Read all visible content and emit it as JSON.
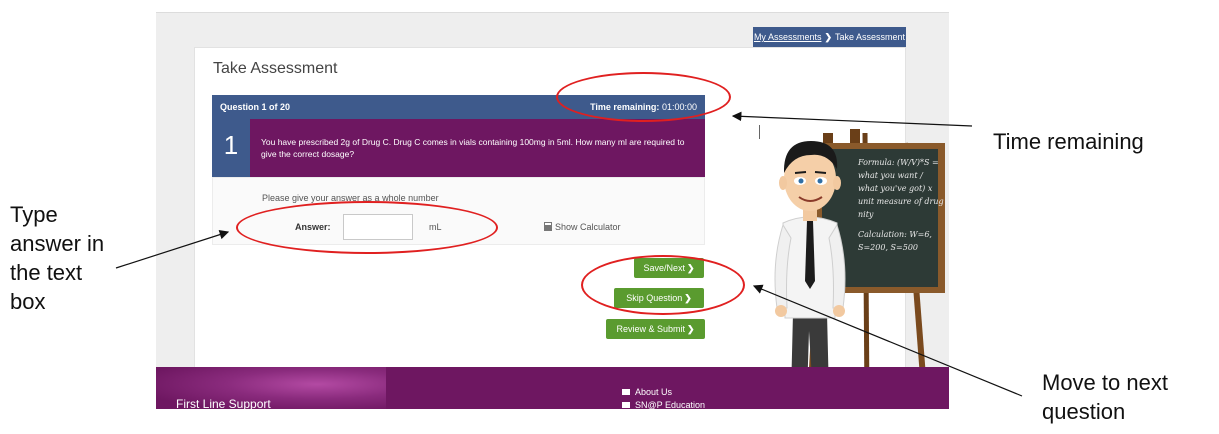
{
  "annotations": {
    "type_answer": "Type answer in the text box",
    "time_remaining": "Time remaining",
    "move_next": "Move to next question"
  },
  "breadcrumb": {
    "link": "My Assessments",
    "separator": "❯",
    "current": "Take Assessment"
  },
  "page_title": "Take Assessment",
  "question": {
    "counter": "Question 1 of 20",
    "time_label": "Time remaining:",
    "time_value": "01:00:00",
    "number": "1",
    "text": "You have prescribed 2g of Drug C. Drug C comes in vials containing 100mg in 5ml. How many ml are required to give the correct dosage?"
  },
  "answer": {
    "instruction": "Please give your answer as a whole number",
    "label": "Answer:",
    "value": "",
    "unit": "mL",
    "calculator": "Show Calculator"
  },
  "buttons": {
    "save_next": "Save/Next",
    "skip": "Skip Question",
    "review": "Review & Submit",
    "arrow": "❯"
  },
  "chalkboard": {
    "line1": "Formula: (W/V)*S =",
    "line2": "what you want /",
    "line3": "what you've got) x",
    "line4": "unit measure of drug",
    "line5": "nity",
    "line6": "Calculation: W=6,",
    "line7": "S=200, S=500"
  },
  "footer": {
    "title": "First Line Support",
    "about": "About Us",
    "education": "SN@P Education"
  },
  "colors": {
    "navy": "#3e5a8c",
    "purple": "#6e1761",
    "green": "#5a9b2f",
    "annotation_red": "#e02020"
  }
}
